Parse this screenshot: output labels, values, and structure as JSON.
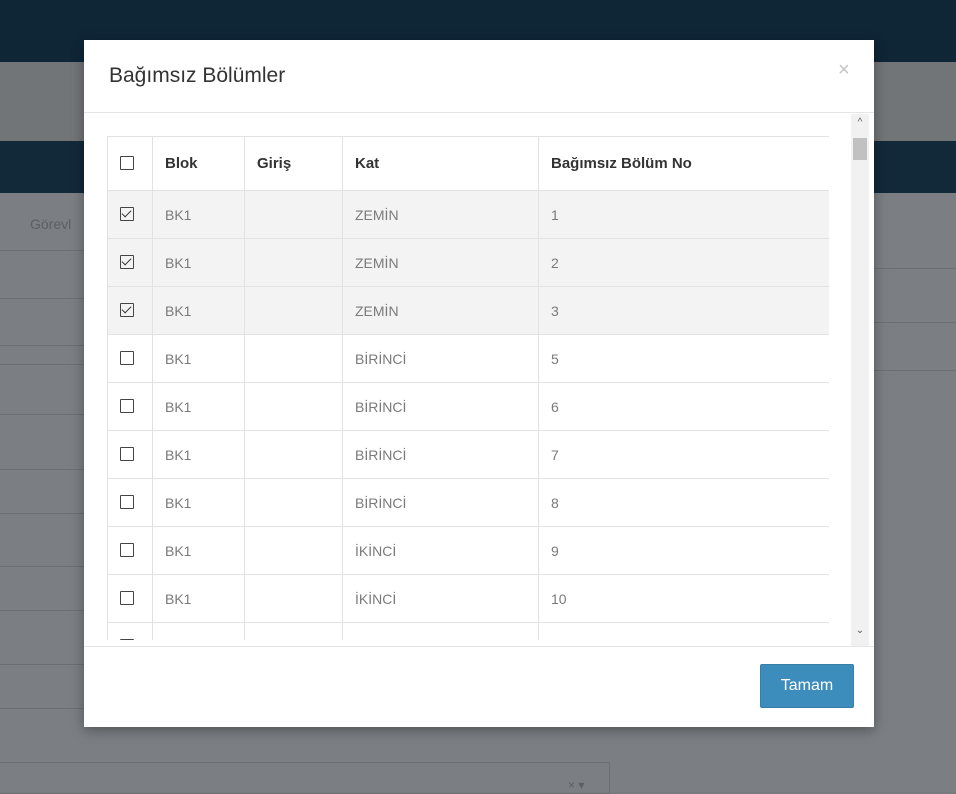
{
  "background": {
    "task_label": "Görevl",
    "select_icons": "× ▾"
  },
  "modal": {
    "title": "Bağımsız Bölümler",
    "close_label": "×",
    "ok_label": "Tamam"
  },
  "table": {
    "headers": [
      "Blok",
      "Giriş",
      "Kat",
      "Bağımsız Bölüm No"
    ],
    "rows": [
      {
        "checked": true,
        "blok": "BK1",
        "giris": "",
        "kat": "ZEMİN",
        "no": "1"
      },
      {
        "checked": true,
        "blok": "BK1",
        "giris": "",
        "kat": "ZEMİN",
        "no": "2"
      },
      {
        "checked": true,
        "blok": "BK1",
        "giris": "",
        "kat": "ZEMİN",
        "no": "3"
      },
      {
        "checked": false,
        "blok": "BK1",
        "giris": "",
        "kat": "BİRİNCİ",
        "no": "5"
      },
      {
        "checked": false,
        "blok": "BK1",
        "giris": "",
        "kat": "BİRİNCİ",
        "no": "6"
      },
      {
        "checked": false,
        "blok": "BK1",
        "giris": "",
        "kat": "BİRİNCİ",
        "no": "7"
      },
      {
        "checked": false,
        "blok": "BK1",
        "giris": "",
        "kat": "BİRİNCİ",
        "no": "8"
      },
      {
        "checked": false,
        "blok": "BK1",
        "giris": "",
        "kat": "İKİNCİ",
        "no": "9"
      },
      {
        "checked": false,
        "blok": "BK1",
        "giris": "",
        "kat": "İKİNCİ",
        "no": "10"
      },
      {
        "checked": false,
        "blok": "",
        "giris": "",
        "kat": "",
        "no": ""
      }
    ]
  },
  "scrollbar": {
    "up_icon": "^",
    "down_icon": "⌄"
  },
  "colors": {
    "primary_button": "#3c8dbc",
    "topbar": "#0f2637"
  }
}
